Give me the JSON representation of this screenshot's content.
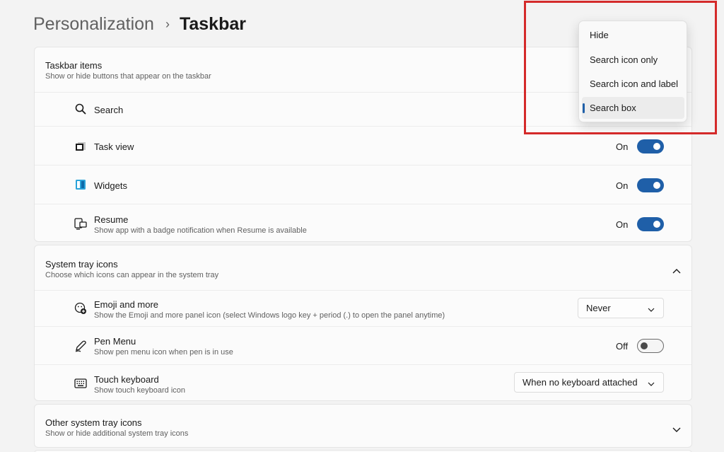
{
  "breadcrumb": {
    "parent": "Personalization",
    "separator": "›",
    "current": "Taskbar"
  },
  "taskbar_items": {
    "title": "Taskbar items",
    "subtitle": "Show or hide buttons that appear on the taskbar",
    "rows": [
      {
        "label": "Search",
        "icon": "search-icon"
      },
      {
        "label": "Task view",
        "icon": "task-view-icon",
        "state": "On"
      },
      {
        "label": "Widgets",
        "icon": "widgets-icon",
        "state": "On"
      },
      {
        "label": "Resume",
        "subtitle": "Show app with a badge notification when Resume is available",
        "icon": "resume-icon",
        "state": "On"
      }
    ]
  },
  "system_tray": {
    "title": "System tray icons",
    "subtitle": "Choose which icons can appear in the system tray",
    "rows": [
      {
        "label": "Emoji and more",
        "subtitle": "Show the Emoji and more panel icon (select Windows logo key + period (.) to open the panel anytime)",
        "icon": "emoji-icon",
        "value": "Never"
      },
      {
        "label": "Pen Menu",
        "subtitle": "Show pen menu icon when pen is in use",
        "icon": "pen-icon",
        "state": "Off"
      },
      {
        "label": "Touch keyboard",
        "subtitle": "Show touch keyboard icon",
        "icon": "keyboard-icon",
        "value": "When no keyboard attached"
      }
    ]
  },
  "other_tray": {
    "title": "Other system tray icons",
    "subtitle": "Show or hide additional system tray icons"
  },
  "search_flyout": {
    "options": [
      "Hide",
      "Search icon only",
      "Search icon and label",
      "Search box"
    ],
    "selected": "Search box"
  },
  "colors": {
    "accent": "#1f5fa8",
    "highlight": "#d42a2a"
  }
}
